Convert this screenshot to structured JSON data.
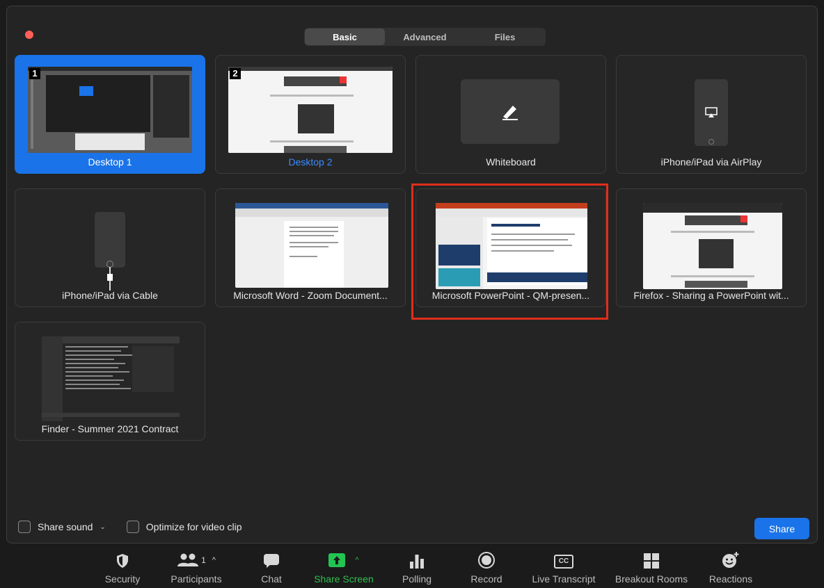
{
  "tabs": [
    "Basic",
    "Advanced",
    "Files"
  ],
  "tiles": [
    {
      "label": "Desktop 1",
      "badge": "1"
    },
    {
      "label": "Desktop 2",
      "badge": "2"
    },
    {
      "label": "Whiteboard"
    },
    {
      "label": "iPhone/iPad via AirPlay"
    },
    {
      "label": "iPhone/iPad via Cable"
    },
    {
      "label": "Microsoft Word - Zoom Document..."
    },
    {
      "label": "Microsoft PowerPoint - QM-presen..."
    },
    {
      "label": "Firefox - Sharing a PowerPoint wit..."
    },
    {
      "label": "Finder - Summer 2021 Contract"
    }
  ],
  "options": {
    "share_sound": "Share sound",
    "optimize_video": "Optimize for video clip"
  },
  "share_button": "Share",
  "toolbar": {
    "security": "Security",
    "participants": "Participants",
    "participants_count": "1",
    "chat": "Chat",
    "share_screen": "Share Screen",
    "polling": "Polling",
    "record": "Record",
    "live_transcript": "Live Transcript",
    "live_transcript_icon_text": "CC",
    "breakout_rooms": "Breakout Rooms",
    "reactions": "Reactions"
  },
  "colors": {
    "accent": "#1a73e8",
    "highlight": "#e02d1b",
    "share_green": "#23c552",
    "close": "#ff5f57"
  }
}
